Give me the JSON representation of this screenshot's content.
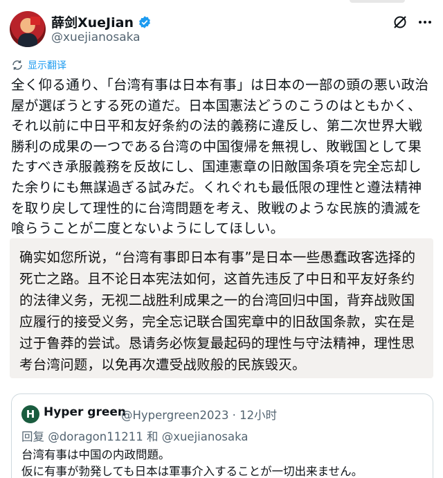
{
  "colors": {
    "accent": "#1d9bf0",
    "text": "#0f1419",
    "secondary": "#536471",
    "translation_bg": "#f3f1ef"
  },
  "author": {
    "display_name": "薛剑XueJian",
    "handle": "@xuejianosaka",
    "verified_icon": "verified-badge-icon"
  },
  "actions": {
    "grok_icon": "grok-icon",
    "more_icon": "more-icon"
  },
  "translate_label": "显示翻译",
  "tweet_text": "全く仰る通り、「台湾有事は日本有事」は日本の一部の頭の悪い政治屋が選ぼうとする死の道だ。日本国憲法どうのこうのはともかく、それ以前に中日平和友好条約の法的義務に違反し、第二次世界大戦勝利の成果の一つである台湾の中国復帰を無視し、敗戦国として果たすべき承服義務を反故にし、国連憲章の旧敵国条項を完全忘却した余りにも無謀過ぎる試みだ。くれぐれも最低限の理性と遵法精神を取り戻して理性的に台湾問題を考え、敗戦のような民族的潰滅を喰らうことが二度とないようにしてほしい。",
  "translation_text": "确实如您所说，“台湾有事即日本有事”是日本一些愚蠢政客选择的死亡之路。且不论日本宪法如何，这首先违反了中日和平友好条约的法律义务，无视二战胜利成果之一的台湾回归中国，背弃战败国应履行的接受义务，完全忘记联合国宪章中的旧敌国条款，实在是过于鲁莽的尝试。恳请务必恢复最起码的理性与守法精神，理性思考台湾问题，以免再次遭受战败般的民族毁灭。",
  "quoted": {
    "avatar_letter": "H",
    "name": "Hyper green",
    "handle_time": "@Hypergreen2023 · 12小时",
    "reply_to": "回复 @doragon11211 和 @xuejianosaka",
    "text": "台湾有事は中国の内政問題。\n仮に有事が勃発しても日本は軍事介入することが一切出来ません。"
  }
}
